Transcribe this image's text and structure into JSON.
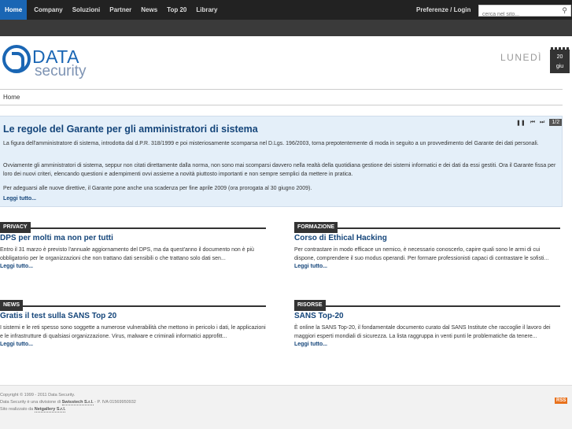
{
  "nav": {
    "items": [
      "Home",
      "Company",
      "Soluzioni",
      "Partner",
      "News",
      "Top 20",
      "Library"
    ],
    "login": "Preferenze / Login",
    "search_placeholder": "cerca nel sito..."
  },
  "header": {
    "logo_data": "DATA",
    "logo_security": "security",
    "day": "LUNEDÌ",
    "date_num": "20",
    "date_month": "giu"
  },
  "breadcrumb": "Home",
  "featured": {
    "title": "Le regole del Garante per gli amministratori di sistema",
    "page": "1/2",
    "p1": "La figura dell'amministratore di sistema, introdotta dal d.P.R. 318/1999 e poi misteriosamente scomparsa nel D.Lgs. 196/2003, torna prepotentemente di moda in seguito a un provvedimento del Garante dei dati personali.",
    "p2": "Ovviamente gli amministratori di sistema, seppur non citati direttamente dalla norma, non sono mai scomparsi davvero nella realtà della quotidiana gestione dei sistemi informatici e dei dati da essi gestiti. Ora il Garante fissa per loro dei nuovi criteri, elencando questioni e adempimenti ovvi assieme a novità piuttosto importanti e non sempre semplici da mettere in pratica.",
    "p3": "Per adeguarsi alle nuove direttive, il Garante pone anche una scadenza per fine aprile 2009 (ora prorogata al 30 giugno 2009).",
    "more": "Leggi tutto..."
  },
  "sections": {
    "privacy": {
      "label": "PRIVACY",
      "title": "DPS per molti ma non per tutti",
      "text": "Entro il 31 marzo è previsto l'annuale aggiornamento del DPS, ma da quest'anno il documento non è più obbligatorio per le organizzazioni che non trattano dati sensibili o che trattano solo dati sen...",
      "more": "Leggi tutto..."
    },
    "formazione": {
      "label": "FORMAZIONE",
      "title": "Corso di Ethical Hacking",
      "text": "Per contrastare in modo efficace un nemico, è necessario conoscerlo, capire quali sono le armi di cui dispone, comprendere il suo modus operandi. Per formare professionisti capaci di contrastare le sofisti...",
      "more": "Leggi tutto..."
    },
    "news": {
      "label": "NEWS",
      "title": "Gratis il test sulla SANS Top 20",
      "text": "I sistemi e le reti spesso sono soggette a numerose vulnerabilità che mettono in pericolo i dati, le applicazioni e le infrastrutture di qualsiasi organizzazione. Virus, malware e criminali informatici approfitt...",
      "more": "Leggi tutto..."
    },
    "risorse": {
      "label": "RISORSE",
      "title": "SANS Top-20",
      "text": "È online la SANS Top-20, il fondamentale documento curato dal SANS Institute che raccoglie il lavoro dei maggiori esperti mondiali di sicurezza. La lista raggruppa in venti punti le problematiche da tenere...",
      "more": "Leggi tutto..."
    }
  },
  "footer": {
    "copyright": "Copyright © 1999 - 2011 Data Security.",
    "division_pre": "Data Security è una divisione di ",
    "division_company": "Swisstech S.r.l.",
    "division_post": " - P. IVA 01569950932",
    "made_pre": "Sito realizzato da ",
    "made_company": "Netgallery S.r.l.",
    "rss": "RSS"
  }
}
